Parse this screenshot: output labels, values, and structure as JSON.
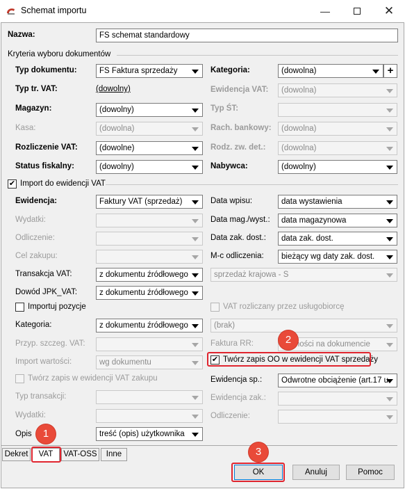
{
  "window": {
    "title": "Schemat importu",
    "min_icon": "minimize-icon",
    "max_icon": "maximize-icon",
    "close_icon": "close-icon"
  },
  "nazwa": {
    "label": "Nazwa:",
    "value": "FS schemat standardowy"
  },
  "kryteria": {
    "heading": "Kryteria wyboru dokumentów"
  },
  "left_fields": [
    {
      "label": "Typ dokumentu:",
      "value": "FS Faktura sprzedaży"
    },
    {
      "label": "Typ tr. VAT:",
      "value": "(dowolny)"
    },
    {
      "label": "Magazyn:",
      "value": "(dowolny)"
    },
    {
      "label": "Kasa:",
      "value": "(dowolna)"
    },
    {
      "label": "Rozliczenie VAT:",
      "value": "(dowolne)"
    },
    {
      "label": "Status fiskalny:",
      "value": "(dowolny)"
    }
  ],
  "right_fields": [
    {
      "label": "Kategoria:",
      "value": "(dowolna)"
    },
    {
      "label": "Ewidencja VAT:",
      "value": "(dowolna)"
    },
    {
      "label": "Typ ŚT:",
      "value": ""
    },
    {
      "label": "Rach. bankowy:",
      "value": "(dowolna)"
    },
    {
      "label": "Rodz. zw. det.:",
      "value": "(dowolna)"
    },
    {
      "label": "Nabywca:",
      "value": "(dowolny)"
    }
  ],
  "import_ewidencji": {
    "label": "Import do ewidencji VAT",
    "checked": "✔"
  },
  "vat_left": [
    {
      "label": "Ewidencja:",
      "value": "Faktury VAT (sprzedaż)"
    },
    {
      "label": "Wydatki:",
      "value": ""
    },
    {
      "label": "Odliczenie:",
      "value": ""
    },
    {
      "label": "Cel zakupu:",
      "value": ""
    },
    {
      "label": "Transakcja VAT:",
      "value": "z dokumentu źródłowego"
    },
    {
      "label": "Dowód JPK_VAT:",
      "value": "z dokumentu źródłowego"
    }
  ],
  "vat_right": [
    {
      "label": "Data wpisu:",
      "value": "data wystawienia"
    },
    {
      "label": "Data mag./wyst.:",
      "value": "data magazynowa"
    },
    {
      "label": "Data zak. dost.:",
      "value": "data zak. dost."
    },
    {
      "label": "M-c odliczenia:",
      "value": "bieżący wg daty zak. dost."
    }
  ],
  "sprzedaz_krajowa": "sprzedaż krajowa - S",
  "importuj_pozycje": "Importuj pozycje",
  "vat_rozliczany": "VAT rozliczany przez usługobiorcę",
  "kategoria2": {
    "label": "Kategoria:",
    "value": "z dokumentu źródłowego",
    "right_value": "(brak)"
  },
  "przyp_szczeg": {
    "label": "Przyp. szczeg. VAT:",
    "value": ""
  },
  "faktura_rr": {
    "label": "Faktura RR:",
    "value": "Płatności na dokumencie"
  },
  "import_wartosci": {
    "label": "Import wartości:",
    "value": "wg dokumentu"
  },
  "tworz_zapis_oo": {
    "label": "Twórz zapis OO w ewidencji VAT sprzedaży",
    "checked": "✔"
  },
  "tworz_zapis_zakupu": "Twórz zapis w ewidencji VAT zakupu",
  "ewidencja_sp": {
    "label": "Ewidencja sp.:",
    "value": "Odwrotne obciążenie (art.17 u"
  },
  "typ_transakcji": {
    "label": "Typ transakcji:",
    "value": ""
  },
  "ewidencja_zak": {
    "label": "Ewidencja zak.:",
    "value": ""
  },
  "wydatki2": {
    "label": "Wydatki:",
    "value": ""
  },
  "odliczenie2": {
    "label": "Odliczenie:",
    "value": ""
  },
  "opis": {
    "label": "Opis",
    "value": "treść (opis) użytkownika"
  },
  "tabs": [
    "Dekret",
    "VAT",
    "VAT-OSS",
    "Inne"
  ],
  "buttons": {
    "ok": "OK",
    "anuluj": "Anuluj",
    "pomoc": "Pomoc"
  },
  "badges": [
    "1",
    "2",
    "3"
  ],
  "colors": {
    "annotation_red": "#e0252f",
    "badge_fill": "#e94a39"
  }
}
